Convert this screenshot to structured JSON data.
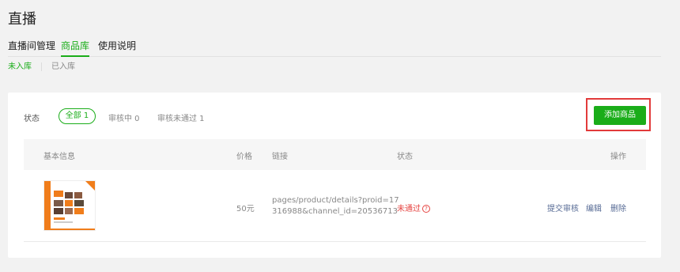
{
  "page": {
    "title": "直播"
  },
  "main_tabs": [
    {
      "label": "直播间管理"
    },
    {
      "label": "商品库"
    },
    {
      "label": "使用说明"
    }
  ],
  "sub_tabs": [
    {
      "label": "未入库"
    },
    {
      "label": "已入库"
    }
  ],
  "filter": {
    "label": "状态",
    "options": [
      {
        "label": "全部 1",
        "selected": true
      },
      {
        "label": "审核中 0",
        "selected": false
      },
      {
        "label": "审核未通过 1",
        "selected": false
      }
    ]
  },
  "toolbar": {
    "add_label": "添加商品"
  },
  "table": {
    "headers": {
      "info": "基本信息",
      "price": "价格",
      "link": "链接",
      "status": "状态",
      "actions": "操作"
    },
    "rows": [
      {
        "price": "50元",
        "link_line1": "pages/product/details?proid=17",
        "link_line2": "316988&channel_id=20536713",
        "status": "未通过",
        "actions": {
          "submit": "提交审核",
          "edit": "编辑",
          "delete": "删除"
        }
      }
    ]
  },
  "colors": {
    "accent": "#1aad19",
    "error": "#e64340",
    "link": "#576b95",
    "highlight_border": "#e23a3a",
    "thumb_orange": "#f07d1b"
  },
  "icons": {
    "status_help": "question-circle-icon"
  }
}
